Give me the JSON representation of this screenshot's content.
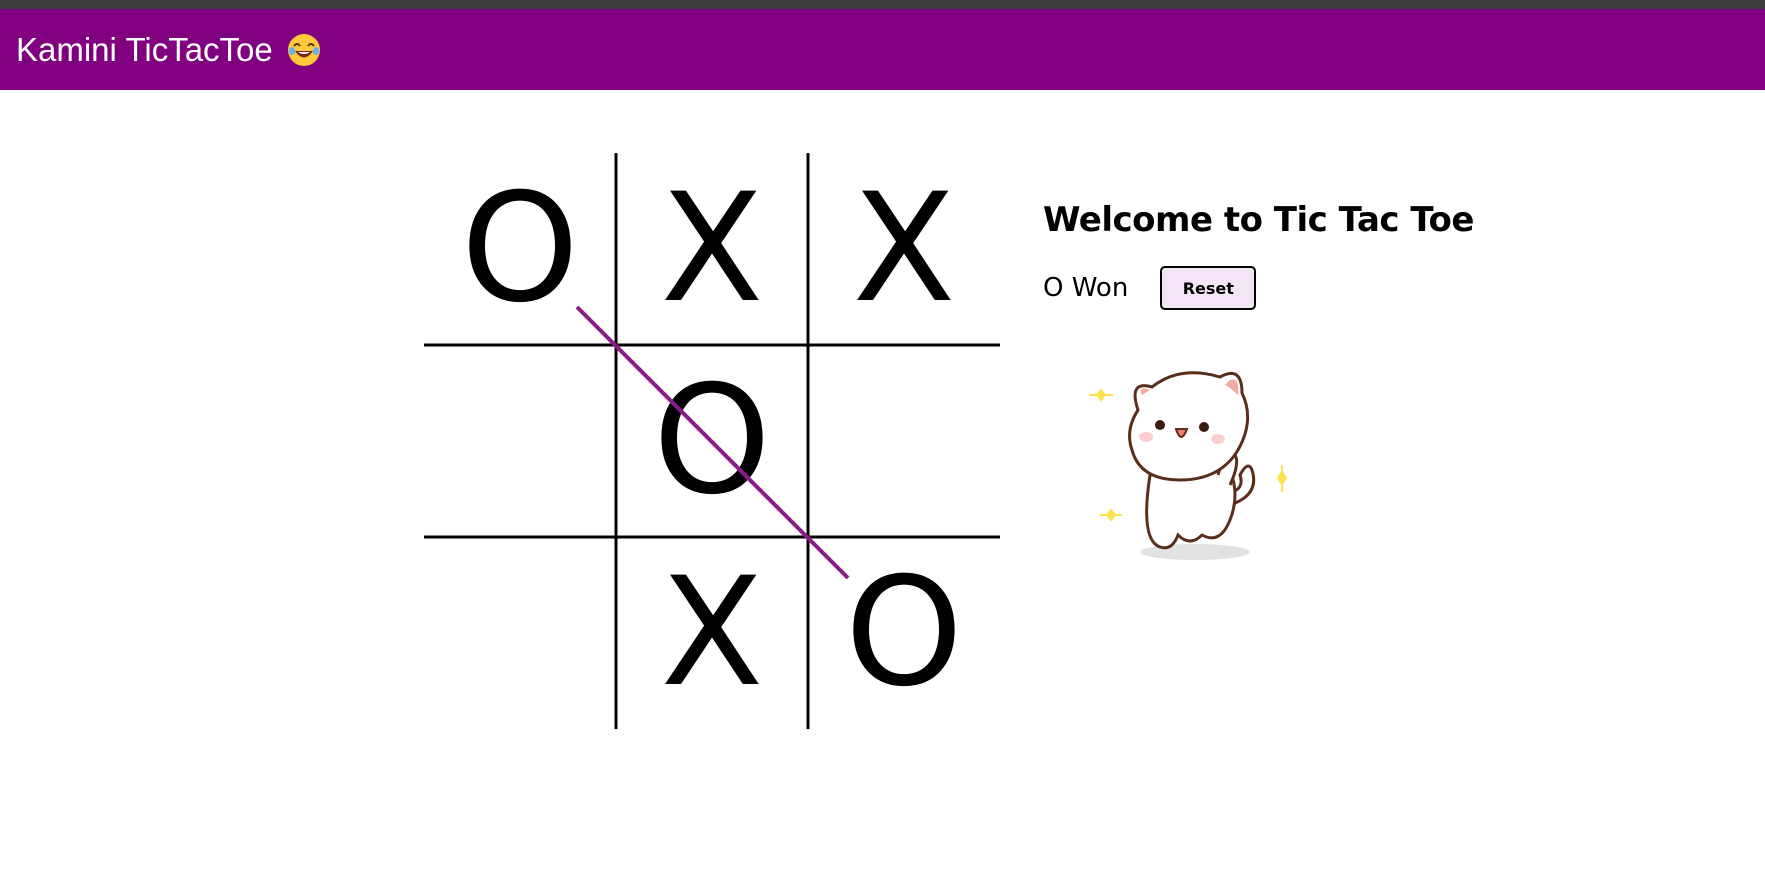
{
  "appbar": {
    "title": "Kamini TicTacToe",
    "emoji_icon": "laughing-face-icon",
    "color": "#800080"
  },
  "board": {
    "cells": [
      "O",
      "X",
      "X",
      "",
      "O",
      "",
      "",
      "X",
      "O"
    ],
    "winning_line": [
      0,
      4,
      8
    ],
    "winning_line_color": "#8b1a8b"
  },
  "panel": {
    "welcome": "Welcome to Tic Tac Toe",
    "status": "O Won",
    "reset_label": "Reset",
    "illustration_icon": "cat-sticker-icon"
  }
}
